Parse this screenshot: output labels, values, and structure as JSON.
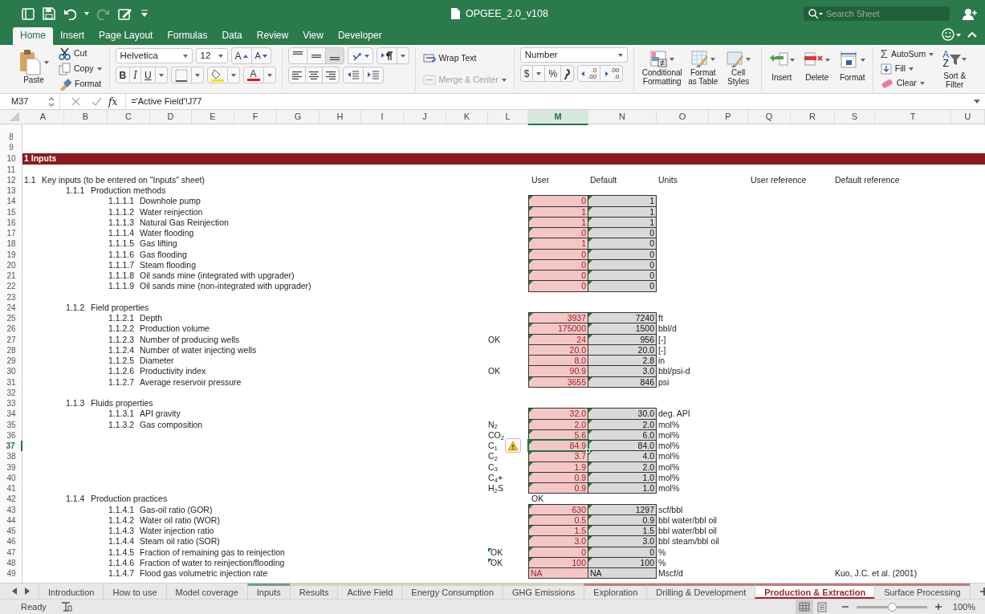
{
  "window": {
    "title": "OPGEE_2.0_v108",
    "search": {
      "placeholder": "Search Sheet"
    }
  },
  "menu_tabs": [
    {
      "label": "Home",
      "selected": true
    },
    {
      "label": "Insert",
      "selected": false
    },
    {
      "label": "Page Layout",
      "selected": false
    },
    {
      "label": "Formulas",
      "selected": false
    },
    {
      "label": "Data",
      "selected": false
    },
    {
      "label": "Review",
      "selected": false
    },
    {
      "label": "View",
      "selected": false
    },
    {
      "label": "Developer",
      "selected": false
    }
  ],
  "ribbon": {
    "clipboard": {
      "paste": "Paste",
      "cut": "Cut",
      "copy": "Copy",
      "format": "Format"
    },
    "font": {
      "name": "Helvetica",
      "size": "12",
      "grow": "A",
      "shrink": "A",
      "bold": "B",
      "italic": "I",
      "underline": "U",
      "color_letter": "A"
    },
    "alignment": {
      "wrap_text": "Wrap Text",
      "merge_center": {
        "label": "Merge & Center",
        "disabled": true
      }
    },
    "number": {
      "format": "Number",
      "currency": "$",
      "percent": "%",
      "increase_decimal": [
        ".0",
        ".00"
      ],
      "decrease_decimal": [
        ".00",
        ".0"
      ]
    },
    "styles": [
      "Conditional Formatting",
      "Format as Table",
      "Cell Styles"
    ],
    "cells": [
      "Insert",
      "Delete",
      "Format"
    ],
    "editing": {
      "autosum_symbol": "Σ",
      "autosum": "AutoSum",
      "fill": "Fill",
      "clear": "Clear",
      "sort_letters": [
        "A",
        "Z"
      ],
      "sort_filter": "Sort & Filter"
    }
  },
  "formula_bar": {
    "name_box": "M37",
    "function_label": "fx",
    "formula": "='Active Field'!J77"
  },
  "columns": [
    {
      "label": "A",
      "selected": false
    },
    {
      "label": "B",
      "selected": false
    },
    {
      "label": "C",
      "selected": false
    },
    {
      "label": "D",
      "selected": false
    },
    {
      "label": "E",
      "selected": false
    },
    {
      "label": "F",
      "selected": false
    },
    {
      "label": "G",
      "selected": false
    },
    {
      "label": "H",
      "selected": false
    },
    {
      "label": "I",
      "selected": false
    },
    {
      "label": "J",
      "selected": false
    },
    {
      "label": "K",
      "selected": false
    },
    {
      "label": "L",
      "selected": false
    },
    {
      "label": "M",
      "selected": true
    },
    {
      "label": "N",
      "selected": false
    },
    {
      "label": "O",
      "selected": false
    },
    {
      "label": "P",
      "selected": false
    },
    {
      "label": "Q",
      "selected": false
    },
    {
      "label": "R",
      "selected": false
    },
    {
      "label": "S",
      "selected": false
    },
    {
      "label": "T",
      "selected": false
    },
    {
      "label": "U",
      "selected": false
    }
  ],
  "rows": [
    {
      "num": "8",
      "kind": "blank"
    },
    {
      "num": "9",
      "kind": "blank"
    },
    {
      "num": "10",
      "kind": "banner",
      "text": "1 Inputs"
    },
    {
      "num": "11",
      "kind": "blank"
    },
    {
      "num": "12",
      "kind": "section",
      "number": "1.1",
      "label": "Key inputs (to be entered on \"Inputs\" sheet)",
      "headers": {
        "user": "User",
        "default": "Default",
        "units": "Units",
        "user_reference": "User reference",
        "default_reference": "Default reference"
      }
    },
    {
      "num": "13",
      "kind": "group",
      "number": "1.1.1",
      "label": "Production methods"
    },
    {
      "num": "14",
      "kind": "item",
      "number": "1.1.1.1",
      "label": "Downhole pump",
      "user": "0",
      "default": "1",
      "flagged": true,
      "noted": false,
      "selected": false,
      "warning": false
    },
    {
      "num": "15",
      "kind": "item",
      "number": "1.1.1.2",
      "label": "Water reinjection",
      "user": "1",
      "default": "1",
      "flagged": true,
      "noted": false,
      "selected": false,
      "warning": false
    },
    {
      "num": "16",
      "kind": "item",
      "number": "1.1.1.3",
      "label": "Natural Gas Reinjection",
      "user": "1",
      "default": "1",
      "flagged": true,
      "noted": false,
      "selected": false,
      "warning": false
    },
    {
      "num": "17",
      "kind": "item",
      "number": "1.1.1.4",
      "label": "Water flooding",
      "user": "0",
      "default": "0",
      "flagged": true,
      "noted": false,
      "selected": false,
      "warning": false
    },
    {
      "num": "18",
      "kind": "item",
      "number": "1.1.1.5",
      "label": "Gas lifting",
      "user": "1",
      "default": "0",
      "flagged": true,
      "noted": false,
      "selected": false,
      "warning": false
    },
    {
      "num": "19",
      "kind": "item",
      "number": "1.1.1.6",
      "label": "Gas flooding",
      "user": "0",
      "default": "0",
      "flagged": true,
      "noted": false,
      "selected": false,
      "warning": false
    },
    {
      "num": "20",
      "kind": "item",
      "number": "1.1.1.7",
      "label": "Steam flooding",
      "user": "0",
      "default": "0",
      "flagged": true,
      "noted": false,
      "selected": false,
      "warning": false
    },
    {
      "num": "21",
      "kind": "item",
      "number": "1.1.1.8",
      "label": "Oil sands mine (integrated with upgrader)",
      "user": "0",
      "default": "0",
      "flagged": true,
      "noted": false,
      "selected": false,
      "warning": false
    },
    {
      "num": "22",
      "kind": "item",
      "number": "1.1.1.9",
      "label": "Oil sands mine (non-integrated with upgrader)",
      "user": "0",
      "default": "0",
      "flagged": true,
      "noted": false,
      "selected": false,
      "warning": false
    },
    {
      "num": "23",
      "kind": "blank"
    },
    {
      "num": "24",
      "kind": "group",
      "number": "1.1.2",
      "label": "Field properties"
    },
    {
      "num": "25",
      "kind": "item",
      "number": "1.1.2.1",
      "label": "Depth",
      "user": "3937",
      "default": "7240",
      "unit": "ft",
      "flagged": true,
      "noted": false,
      "selected": false,
      "warning": false
    },
    {
      "num": "26",
      "kind": "item",
      "number": "1.1.2.2",
      "label": "Production volume",
      "user": "175000",
      "default": "1500",
      "unit": "bbl/d",
      "flagged": true,
      "noted": false,
      "selected": false,
      "warning": false
    },
    {
      "num": "27",
      "kind": "item",
      "number": "1.1.2.3",
      "label": "Number of producing wells",
      "check": "OK",
      "user": "24",
      "default": "956",
      "unit": "[-]",
      "flagged": true,
      "noted": false,
      "selected": false,
      "warning": false
    },
    {
      "num": "28",
      "kind": "item",
      "number": "1.1.2.4",
      "label": "Number of water injecting wells",
      "user": "20.0",
      "default": "20.0",
      "unit": "[-]",
      "flagged": false,
      "noted": false,
      "selected": false,
      "warning": false
    },
    {
      "num": "29",
      "kind": "item",
      "number": "1.1.2.5",
      "label": "Diameter",
      "user": "8.0",
      "default": "2.8",
      "unit": "in",
      "flagged": false,
      "noted": false,
      "selected": false,
      "warning": false
    },
    {
      "num": "30",
      "kind": "item",
      "number": "1.1.2.6",
      "label": "Productivity index",
      "check": "OK",
      "user": "90.9",
      "default": "3.0",
      "unit": "bbl/psi-d",
      "flagged": false,
      "noted": false,
      "selected": false,
      "warning": false
    },
    {
      "num": "31",
      "kind": "item",
      "number": "1.1.2.7",
      "label": "Average reservoir pressure",
      "user": "3655",
      "default": "846",
      "unit": "psi",
      "flagged": true,
      "noted": false,
      "selected": false,
      "warning": false
    },
    {
      "num": "32",
      "kind": "blank"
    },
    {
      "num": "33",
      "kind": "group",
      "number": "1.1.3",
      "label": "Fluids properties"
    },
    {
      "num": "34",
      "kind": "item",
      "number": "1.1.3.1",
      "label": "API gravity",
      "user": "32.0",
      "default": "30.0",
      "unit": "deg. API",
      "flagged": true,
      "noted": false,
      "selected": false,
      "warning": false
    },
    {
      "num": "35",
      "kind": "item",
      "number": "1.1.3.2",
      "label": "Gas composition",
      "check": "N$_{2}$",
      "user": "2.0",
      "default": "2.0",
      "unit": "mol%",
      "flagged": true,
      "noted": false,
      "selected": false,
      "warning": false
    },
    {
      "num": "36",
      "kind": "item",
      "check": "CO$_{2}$",
      "user": "5.6",
      "default": "6.0",
      "unit": "mol%",
      "flagged": true,
      "noted": false,
      "selected": false,
      "warning": false
    },
    {
      "num": "37",
      "kind": "item",
      "check": "C$_{1}$",
      "user": "84.9",
      "default": "84.0",
      "unit": "mol%",
      "flagged": true,
      "noted": false,
      "selected": true,
      "warning": true
    },
    {
      "num": "38",
      "kind": "item",
      "check": "C$_{2}$",
      "user": "3.7",
      "default": "4.0",
      "unit": "mol%",
      "flagged": true,
      "noted": false,
      "selected": false,
      "warning": false
    },
    {
      "num": "39",
      "kind": "item",
      "check": "C$_{3}$",
      "user": "1.9",
      "default": "2.0",
      "unit": "mol%",
      "flagged": true,
      "noted": false,
      "selected": false,
      "warning": false
    },
    {
      "num": "40",
      "kind": "item",
      "check": "C$_{4}$+",
      "user": "0.9",
      "default": "1.0",
      "unit": "mol%",
      "flagged": true,
      "noted": false,
      "selected": false,
      "warning": false
    },
    {
      "num": "41",
      "kind": "item",
      "check": "H$_{2}$S",
      "user": "0.9",
      "default": "1.0",
      "unit": "mol%",
      "flagged": true,
      "noted": false,
      "selected": false,
      "warning": false
    },
    {
      "num": "42",
      "kind": "group",
      "number": "1.1.4",
      "label": "Production practices",
      "status": "OK"
    },
    {
      "num": "43",
      "kind": "item",
      "number": "1.1.4.1",
      "label": "Gas-oil ratio (GOR)",
      "user": "630",
      "default": "1297",
      "unit": "scf/bbl",
      "flagged": true,
      "noted": false,
      "selected": false,
      "warning": false
    },
    {
      "num": "44",
      "kind": "item",
      "number": "1.1.4.2",
      "label": "Water oil ratio (WOR)",
      "user": "0.5",
      "default": "0.9",
      "unit": "bbl water/bbl oil",
      "flagged": true,
      "noted": false,
      "selected": false,
      "warning": false
    },
    {
      "num": "45",
      "kind": "item",
      "number": "1.1.4.3",
      "label": "Water injection ratio",
      "user": "1.5",
      "default": "1.5",
      "unit": "bbl water/bbl oil",
      "flagged": true,
      "noted": false,
      "selected": false,
      "warning": false
    },
    {
      "num": "46",
      "kind": "item",
      "number": "1.1.4.4",
      "label": "Steam oil ratio (SOR)",
      "user": "3.0",
      "default": "3.0",
      "unit": "bbl steam/bbl oil",
      "flagged": true,
      "noted": false,
      "selected": false,
      "warning": false
    },
    {
      "num": "47",
      "kind": "item",
      "number": "1.1.4.5",
      "label": "Fraction of remaining gas to reinjection",
      "check": "OK",
      "user": "0",
      "default": "0",
      "unit": "%",
      "flagged": true,
      "noted": true,
      "selected": false,
      "warning": false
    },
    {
      "num": "48",
      "kind": "item",
      "number": "1.1.4.6",
      "label": "Fraction of water to reinjection/flooding",
      "check": "OK",
      "user": "100",
      "default": "100",
      "unit": "%",
      "flagged": true,
      "noted": true,
      "selected": false,
      "warning": false
    },
    {
      "num": "49",
      "kind": "text_item",
      "number": "1.1.4.7",
      "label": "Flood gas volumetric injection rate",
      "user": "NA",
      "default": "NA",
      "unit": "Mscf/d",
      "reference": "Kuo, J.C. et al. (2001)",
      "flagged": false,
      "noted": false,
      "selected": false,
      "warning": false
    }
  ],
  "sheet_tabs": [
    {
      "label": "Introduction",
      "selected": false
    },
    {
      "label": "How to use",
      "selected": false
    },
    {
      "label": "Model coverage",
      "selected": false
    },
    {
      "label": "Inputs",
      "selected": false,
      "color": "#6a9f91"
    },
    {
      "label": "Results",
      "selected": false,
      "color": "#d8d2b8"
    },
    {
      "label": "Active Field",
      "selected": false,
      "color": "#d8d2b8"
    },
    {
      "label": "Energy Consumption",
      "selected": false,
      "color": "#d8d2b8"
    },
    {
      "label": "GHG Emissions",
      "selected": false,
      "color": "#d8d2b8"
    },
    {
      "label": "Exploration",
      "selected": false,
      "color": "#c27b7b"
    },
    {
      "label": "Drilling & Development",
      "selected": false,
      "color": "#c27b7b"
    },
    {
      "label": "Production & Extraction",
      "selected": true,
      "color": "#c27b7b"
    },
    {
      "label": "Surface Processing",
      "selected": false,
      "color": "#c27b7b"
    }
  ],
  "status_bar": {
    "status": "Ready",
    "views": [
      {
        "kind": "normal",
        "selected": true
      },
      {
        "kind": "page_layout",
        "selected": false
      }
    ],
    "zoom": {
      "level": 0.5,
      "reading": "100%"
    }
  }
}
